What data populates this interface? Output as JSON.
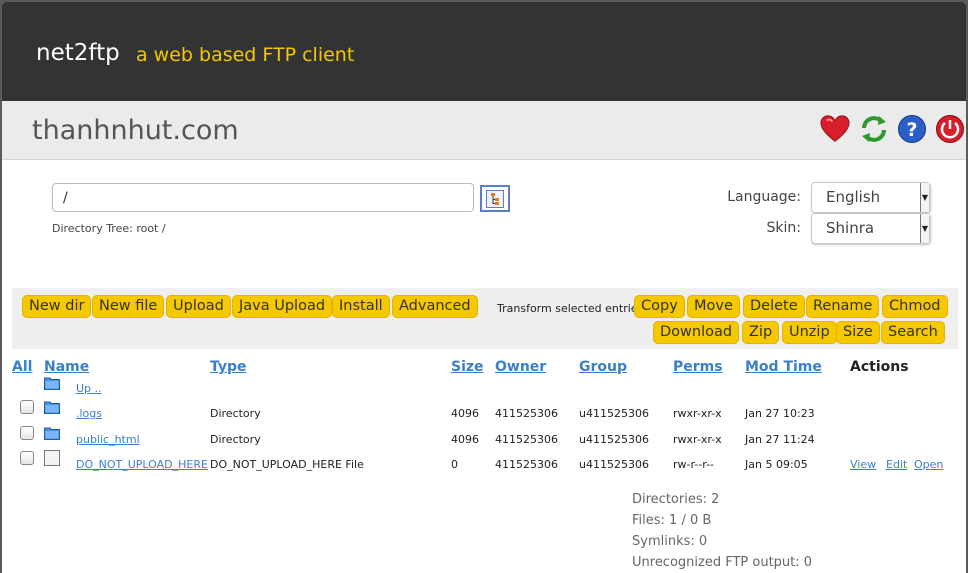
{
  "header": {
    "app_name": "net2ftp",
    "tagline": "a web based FTP client"
  },
  "site": {
    "name": "thanhnhut.com"
  },
  "header_icons": [
    "heart-icon",
    "refresh-icon",
    "help-icon",
    "power-icon"
  ],
  "directory": {
    "value": "/",
    "tree_label": "Directory Tree: root /"
  },
  "settings": {
    "language_label": "Language:",
    "language_value": "English",
    "skin_label": "Skin:",
    "skin_value": "Shinra"
  },
  "toolbar": {
    "new_dir": "New dir",
    "new_file": "New file",
    "upload": "Upload",
    "java_upload": "Java Upload",
    "install": "Install",
    "advanced": "Advanced",
    "transform_label": "Transform selected entries:",
    "copy": "Copy",
    "move": "Move",
    "delete": "Delete",
    "rename": "Rename",
    "chmod": "Chmod",
    "download": "Download",
    "zip": "Zip",
    "unzip": "Unzip",
    "size": "Size",
    "search": "Search"
  },
  "table": {
    "headers": {
      "all": "All",
      "name": "Name",
      "type": "Type",
      "size": "Size",
      "owner": "Owner",
      "group": "Group",
      "perms": "Perms",
      "mod_time": "Mod Time",
      "actions": "Actions"
    },
    "up_label": "Up ..",
    "rows": [
      {
        "name": ".logs",
        "type": "Directory",
        "size": "4096",
        "owner": "411525306",
        "group": "u411525306",
        "perms": "rwxr-xr-x",
        "mod": "Jan 27 10:23"
      },
      {
        "name": "public_html",
        "type": "Directory",
        "size": "4096",
        "owner": "411525306",
        "group": "u411525306",
        "perms": "rwxr-xr-x",
        "mod": "Jan 27 11:24"
      },
      {
        "name": "DO_NOT_UPLOAD_HERE",
        "type": "DO_NOT_UPLOAD_HERE File",
        "size": "0",
        "owner": "411525306",
        "group": "u411525306",
        "perms": "rw-r--r--",
        "mod": "Jan 5 09:05",
        "actions": [
          "View",
          "Edit",
          "Open"
        ]
      }
    ]
  },
  "stats": {
    "directories": "Directories: 2",
    "files": "Files: 1 / 0 B",
    "symlinks": "Symlinks: 0",
    "unrecognized": "Unrecognized FTP output: 0"
  },
  "colors": {
    "accent": "#f5c800",
    "header_bg": "#333333",
    "link": "#3a7fc8"
  }
}
